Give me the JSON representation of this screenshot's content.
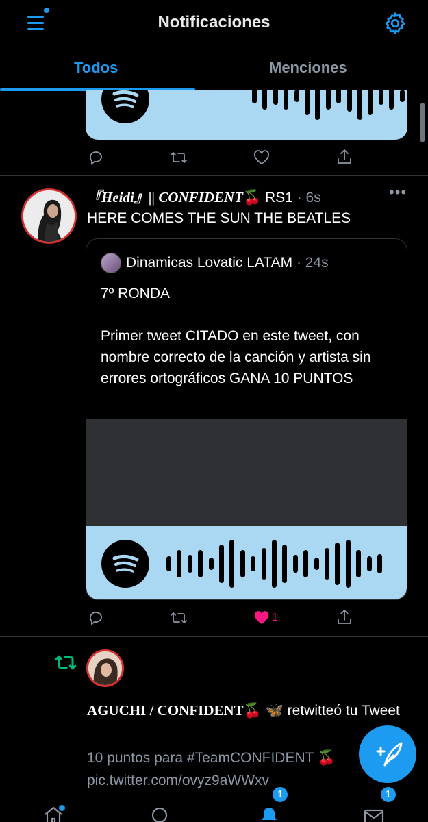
{
  "header": {
    "title": "Notificaciones"
  },
  "tabs": [
    {
      "label": "Todos",
      "active": true
    },
    {
      "label": "Menciones",
      "active": false
    }
  ],
  "tweet2": {
    "display_name": "『Heidi』|| CONFIDENT",
    "name_emoji": "🍒",
    "name_suffix": " RS1",
    "time": "· 6s",
    "more": "•••",
    "text": "HERE COMES THE SUN THE BEATLES",
    "quote": {
      "name": "Dinamicas Lovatic LATAM",
      "time": "· 24s",
      "line1": "7º RONDA",
      "line2": "Primer tweet CITADO en este tweet, con nombre correcto de la canción y artista sin errores ortográficos GANA 10 PUNTOS"
    },
    "like_count": "1"
  },
  "retweet": {
    "name": "AGUCHI / CONFIDENT",
    "name_emoji": "🍒 🦋",
    "action_text": " retwitteó tu Tweet",
    "tweet_text": "10 puntos para #TeamCONFIDENT 🍒 pic.twitter.com/ovyz9aWWxv"
  },
  "bottom_nav": {
    "notifications_badge": "1",
    "messages_badge": "1"
  },
  "colors": {
    "accent": "#1d9bf0",
    "like": "#f91880",
    "retweet": "#00ba7c",
    "spotify_card": "#aad8f3"
  }
}
